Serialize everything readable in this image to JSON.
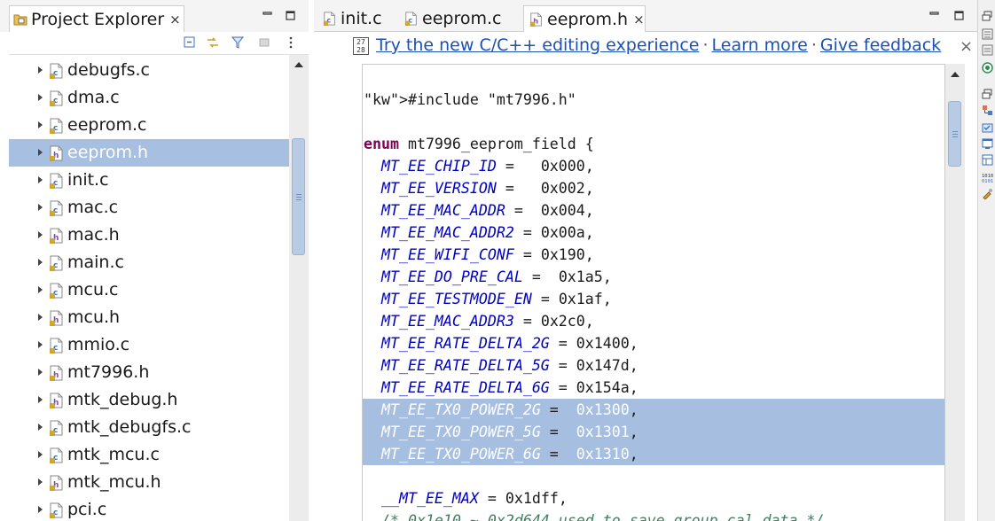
{
  "explorer": {
    "tab_title": "Project Explorer",
    "close_glyph": "×",
    "minimize_glyph": "▭",
    "maximize_glyph": "□",
    "toolbar_icons": [
      "collapse-all-icon",
      "link-with-editor-icon",
      "filter-icon",
      "focus-icon",
      "view-menu-icon"
    ],
    "items": [
      {
        "label": "debugfs.c",
        "type": "c"
      },
      {
        "label": "dma.c",
        "type": "c"
      },
      {
        "label": "eeprom.c",
        "type": "c"
      },
      {
        "label": "eeprom.h",
        "type": "h",
        "selected": true
      },
      {
        "label": "init.c",
        "type": "c"
      },
      {
        "label": "mac.c",
        "type": "c"
      },
      {
        "label": "mac.h",
        "type": "h"
      },
      {
        "label": "main.c",
        "type": "c"
      },
      {
        "label": "mcu.c",
        "type": "c"
      },
      {
        "label": "mcu.h",
        "type": "h"
      },
      {
        "label": "mmio.c",
        "type": "c"
      },
      {
        "label": "mt7996.h",
        "type": "h"
      },
      {
        "label": "mtk_debug.h",
        "type": "h"
      },
      {
        "label": "mtk_debugfs.c",
        "type": "c"
      },
      {
        "label": "mtk_mcu.c",
        "type": "c"
      },
      {
        "label": "mtk_mcu.h",
        "type": "h"
      },
      {
        "label": "pci.c",
        "type": "c"
      }
    ]
  },
  "editor": {
    "tabs": [
      {
        "label": "init.c",
        "type": "c",
        "active": false
      },
      {
        "label": "eeprom.c",
        "type": "c",
        "active": false
      },
      {
        "label": "eeprom.h",
        "type": "h",
        "active": true
      }
    ],
    "close_glyph": "×",
    "notification": {
      "message": "Try the new C/C++ editing experience",
      "link_learn": "Learn more",
      "link_feedback": "Give feedback",
      "separator": "·",
      "close_glyph": "×"
    },
    "code_lines": [
      "",
      "#include \"mt7996.h\"",
      "",
      "enum mt7996_eeprom_field {",
      "  MT_EE_CHIP_ID =   0x000,",
      "  MT_EE_VERSION =   0x002,",
      "  MT_EE_MAC_ADDR =  0x004,",
      "  MT_EE_MAC_ADDR2 = 0x00a,",
      "  MT_EE_WIFI_CONF = 0x190,",
      "  MT_EE_DO_PRE_CAL =  0x1a5,",
      "  MT_EE_TESTMODE_EN = 0x1af,",
      "  MT_EE_MAC_ADDR3 = 0x2c0,",
      "  MT_EE_RATE_DELTA_2G = 0x1400,",
      "  MT_EE_RATE_DELTA_5G = 0x147d,",
      "  MT_EE_RATE_DELTA_6G = 0x154a,",
      "  MT_EE_TX0_POWER_2G =  0x1300,",
      "  MT_EE_TX0_POWER_5G =  0x1301,",
      "  MT_EE_TX0_POWER_6G =  0x1310,",
      "",
      "  __MT_EE_MAX = 0x1dff,",
      "  /* 0x1e10 ~ 0x2d644 used to save group cal data */"
    ],
    "highlighted_lines": [
      15,
      16,
      17
    ]
  },
  "trim": {
    "icons": [
      "restore-icon",
      "outline-icon",
      "task-list-icon",
      "build-targets-icon",
      "restore-icon",
      "type-hierarchy-icon",
      "include-browser-icon",
      "console-icon",
      "properties-icon",
      "memory-icon",
      "tools-icon"
    ]
  },
  "colors": {
    "selection": "#a7bfe1",
    "keyword": "#7f0055",
    "string": "#2a00ff",
    "enum_constant": "#0000c0",
    "link": "#1b50b5"
  }
}
